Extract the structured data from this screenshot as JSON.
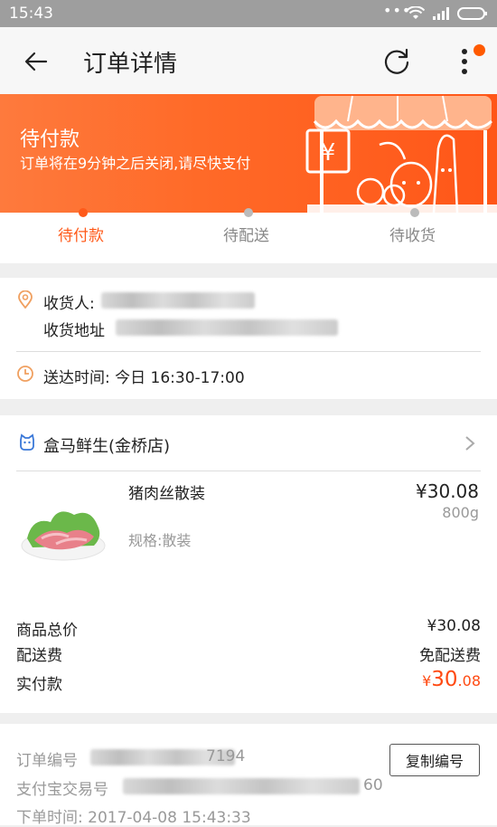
{
  "status_bar": {
    "time": "15:43",
    "dots": "•••"
  },
  "toolbar": {
    "title": "订单详情"
  },
  "banner": {
    "status": "待付款",
    "message": "订单将在9分钟之后关闭,请尽快支付",
    "sign": "¥"
  },
  "steps": [
    {
      "label": "待付款",
      "active": true
    },
    {
      "label": "待配送",
      "active": false
    },
    {
      "label": "待收货",
      "active": false
    }
  ],
  "address": {
    "recipient_label": "收货人:",
    "address_label": "收货地址",
    "delivery_time": "送达时间: 今日 16:30-17:00"
  },
  "store": {
    "name": "盒马鲜生(金桥店)"
  },
  "product": {
    "name": "猪肉丝散装",
    "spec": "规格:散装",
    "price": "¥30.08",
    "weight": "800g"
  },
  "totals": {
    "goods_label": "商品总价",
    "goods_value": "¥30.08",
    "delivery_label": "配送费",
    "delivery_value": "免配送费",
    "paid_label": "实付款",
    "paid_currency": "¥",
    "paid_integer": "30",
    "paid_decimal": ".08"
  },
  "order_meta": {
    "order_no_label": "订单编号",
    "order_no_tail": "7194",
    "alipay_label": "支付宝交易号",
    "alipay_tail": "60",
    "order_time": "下单时间: 2017-04-08 15:43:33",
    "copy_button": "复制编号"
  },
  "colors": {
    "accent": "#ff5a1a",
    "banner": "#ff6a28"
  }
}
